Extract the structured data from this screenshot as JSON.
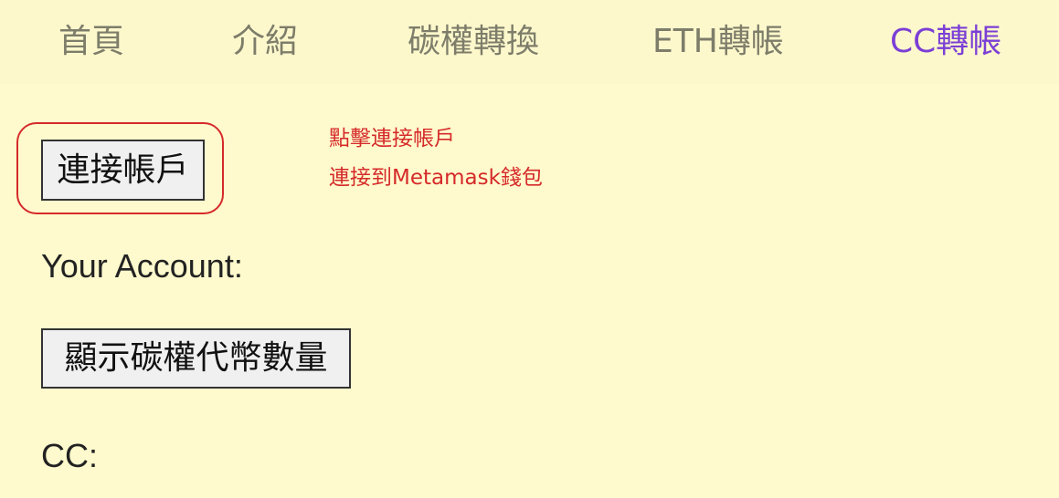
{
  "nav": {
    "items": [
      {
        "label": "首頁"
      },
      {
        "label": "介紹"
      },
      {
        "label": "碳權轉換"
      },
      {
        "label": "ETH轉帳"
      },
      {
        "label": "CC轉帳"
      }
    ],
    "active_color": "#7b3fd6",
    "inactive_color": "#7d7d6a"
  },
  "main": {
    "connect_button_label": "連接帳戶",
    "annotation_line1": "點擊連接帳戶",
    "annotation_line2": "連接到Metamask錢包",
    "account_label": "Your Account:",
    "show_tokens_button_label": "顯示碳權代幣數量",
    "cc_label": "CC:"
  },
  "colors": {
    "background": "#fffacd",
    "annotation": "#d52a2a"
  }
}
